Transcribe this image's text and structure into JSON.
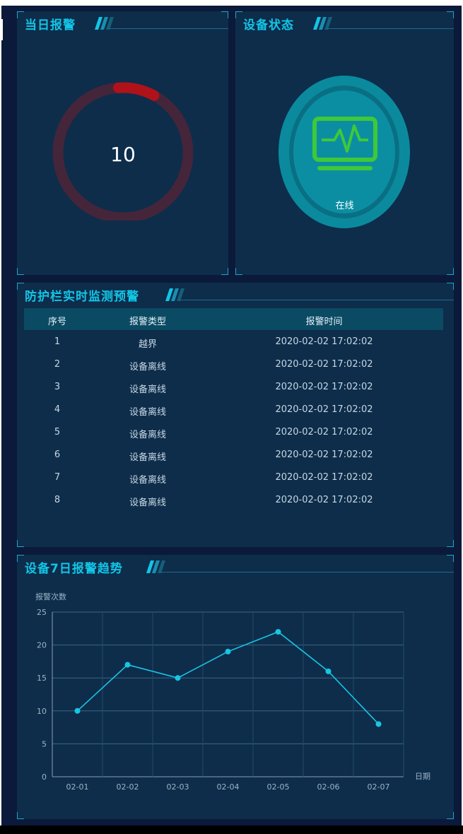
{
  "panels": {
    "alarm_today": {
      "title": "当日报警",
      "count": "10",
      "gauge_fraction": 0.09
    },
    "device_status": {
      "title": "设备状态",
      "status": "在线",
      "icon": "monitor-pulse-icon"
    },
    "realtime": {
      "title": "防护栏实时监测预警",
      "columns": [
        "序号",
        "报警类型",
        "报警时间"
      ],
      "rows": [
        [
          "1",
          "越界",
          "2020-02-02 17:02:02"
        ],
        [
          "2",
          "设备离线",
          "2020-02-02 17:02:02"
        ],
        [
          "3",
          "设备离线",
          "2020-02-02 17:02:02"
        ],
        [
          "4",
          "设备离线",
          "2020-02-02 17:02:02"
        ],
        [
          "5",
          "设备离线",
          "2020-02-02 17:02:02"
        ],
        [
          "6",
          "设备离线",
          "2020-02-02 17:02:02"
        ],
        [
          "7",
          "设备离线",
          "2020-02-02 17:02:02"
        ],
        [
          "8",
          "设备离线",
          "2020-02-02 17:02:02"
        ]
      ]
    },
    "trend": {
      "title": "设备7日报警趋势"
    }
  },
  "colors": {
    "accent": "#12c5e6",
    "alarm_red": "#b0121a",
    "gauge_track": "#45253a",
    "status_green": "#3ec83a",
    "panel_bg": "#0d2d4b"
  },
  "chart_data": {
    "type": "line",
    "categories": [
      "02-01",
      "02-02",
      "02-03",
      "02-04",
      "02-05",
      "02-06",
      "02-07"
    ],
    "series": [
      {
        "values": [
          10,
          17,
          15,
          19,
          22,
          16,
          8
        ]
      }
    ],
    "xlabel": "日期",
    "ylabel": "报警次数",
    "ylim": [
      0,
      25
    ],
    "yticks": [
      0,
      5,
      10,
      15,
      20,
      25
    ],
    "grid": true
  }
}
